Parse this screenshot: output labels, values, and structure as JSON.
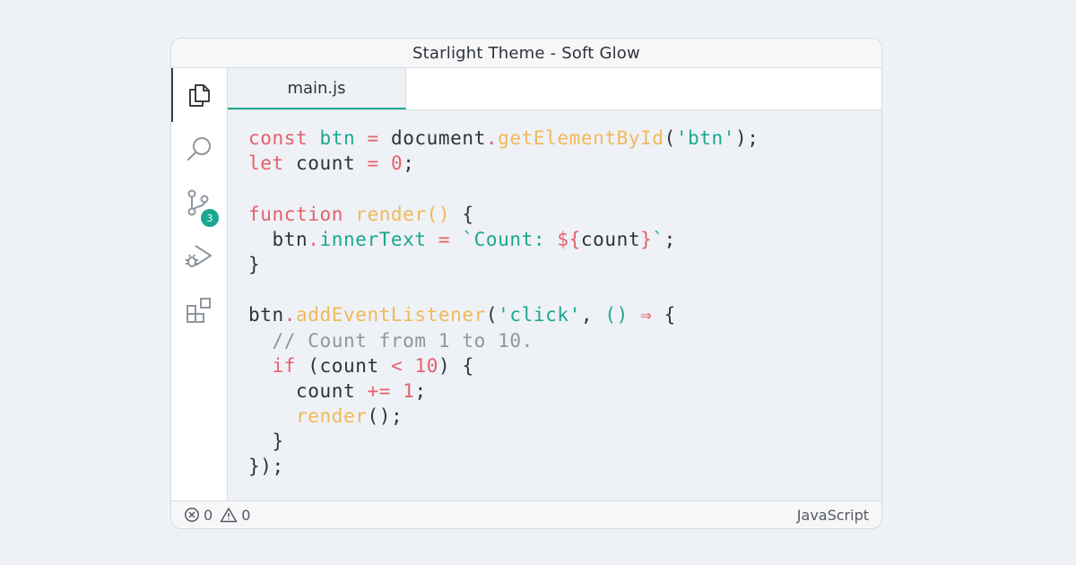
{
  "window": {
    "title": "Starlight Theme - Soft Glow"
  },
  "activity_bar": {
    "items": [
      {
        "icon": "files-icon",
        "active": true
      },
      {
        "icon": "search-icon"
      },
      {
        "icon": "source-control-icon",
        "badge": "3"
      },
      {
        "icon": "run-debug-icon"
      },
      {
        "icon": "extensions-icon"
      }
    ]
  },
  "editor": {
    "tabs": [
      {
        "label": "main.js",
        "active": true
      }
    ],
    "code_lines": [
      [
        {
          "t": "const",
          "c": "kw"
        },
        {
          "t": " ",
          "c": "pl"
        },
        {
          "t": "btn",
          "c": "var"
        },
        {
          "t": " ",
          "c": "pl"
        },
        {
          "t": "=",
          "c": "op"
        },
        {
          "t": " document",
          "c": "pl"
        },
        {
          "t": ".",
          "c": "op"
        },
        {
          "t": "getElementById",
          "c": "fn"
        },
        {
          "t": "(",
          "c": "pl"
        },
        {
          "t": "'btn'",
          "c": "str"
        },
        {
          "t": ");",
          "c": "pl"
        }
      ],
      [
        {
          "t": "let",
          "c": "kw"
        },
        {
          "t": " count ",
          "c": "pl"
        },
        {
          "t": "=",
          "c": "op"
        },
        {
          "t": " ",
          "c": "pl"
        },
        {
          "t": "0",
          "c": "num"
        },
        {
          "t": ";",
          "c": "pl"
        }
      ],
      [],
      [
        {
          "t": "function",
          "c": "kw"
        },
        {
          "t": " ",
          "c": "pl"
        },
        {
          "t": "render",
          "c": "fn"
        },
        {
          "t": "()",
          "c": "fn"
        },
        {
          "t": " {",
          "c": "pl"
        }
      ],
      [
        {
          "t": "  btn",
          "c": "pl"
        },
        {
          "t": ".",
          "c": "op"
        },
        {
          "t": "innerText",
          "c": "var"
        },
        {
          "t": " ",
          "c": "pl"
        },
        {
          "t": "=",
          "c": "op"
        },
        {
          "t": " ",
          "c": "pl"
        },
        {
          "t": "`Count: ",
          "c": "str"
        },
        {
          "t": "${",
          "c": "op"
        },
        {
          "t": "count",
          "c": "pl"
        },
        {
          "t": "}",
          "c": "op"
        },
        {
          "t": "`",
          "c": "str"
        },
        {
          "t": ";",
          "c": "pl"
        }
      ],
      [
        {
          "t": "}",
          "c": "pl"
        }
      ],
      [],
      [
        {
          "t": "btn",
          "c": "pl"
        },
        {
          "t": ".",
          "c": "op"
        },
        {
          "t": "addEventListener",
          "c": "fn"
        },
        {
          "t": "(",
          "c": "pl"
        },
        {
          "t": "'click'",
          "c": "str"
        },
        {
          "t": ", ",
          "c": "pl"
        },
        {
          "t": "()",
          "c": "var"
        },
        {
          "t": " ",
          "c": "pl"
        },
        {
          "t": "⇒",
          "c": "op"
        },
        {
          "t": " {",
          "c": "pl"
        }
      ],
      [
        {
          "t": "  // Count from 1 to 10.",
          "c": "cm"
        }
      ],
      [
        {
          "t": "  ",
          "c": "pl"
        },
        {
          "t": "if",
          "c": "kw"
        },
        {
          "t": " (count ",
          "c": "pl"
        },
        {
          "t": "<",
          "c": "op"
        },
        {
          "t": " ",
          "c": "pl"
        },
        {
          "t": "10",
          "c": "num"
        },
        {
          "t": ") {",
          "c": "pl"
        }
      ],
      [
        {
          "t": "    count ",
          "c": "pl"
        },
        {
          "t": "+=",
          "c": "op"
        },
        {
          "t": " ",
          "c": "pl"
        },
        {
          "t": "1",
          "c": "num"
        },
        {
          "t": ";",
          "c": "pl"
        }
      ],
      [
        {
          "t": "    ",
          "c": "pl"
        },
        {
          "t": "render",
          "c": "fn"
        },
        {
          "t": "();",
          "c": "pl"
        }
      ],
      [
        {
          "t": "  }",
          "c": "pl"
        }
      ],
      [
        {
          "t": "});",
          "c": "pl"
        }
      ]
    ]
  },
  "status_bar": {
    "errors": "0",
    "warnings": "0",
    "language": "JavaScript"
  },
  "colors": {
    "keyword": "#e5606c",
    "variable": "#1aa88f",
    "function": "#f0b95a",
    "comment": "#8f969e",
    "accent": "#1aa88f"
  }
}
